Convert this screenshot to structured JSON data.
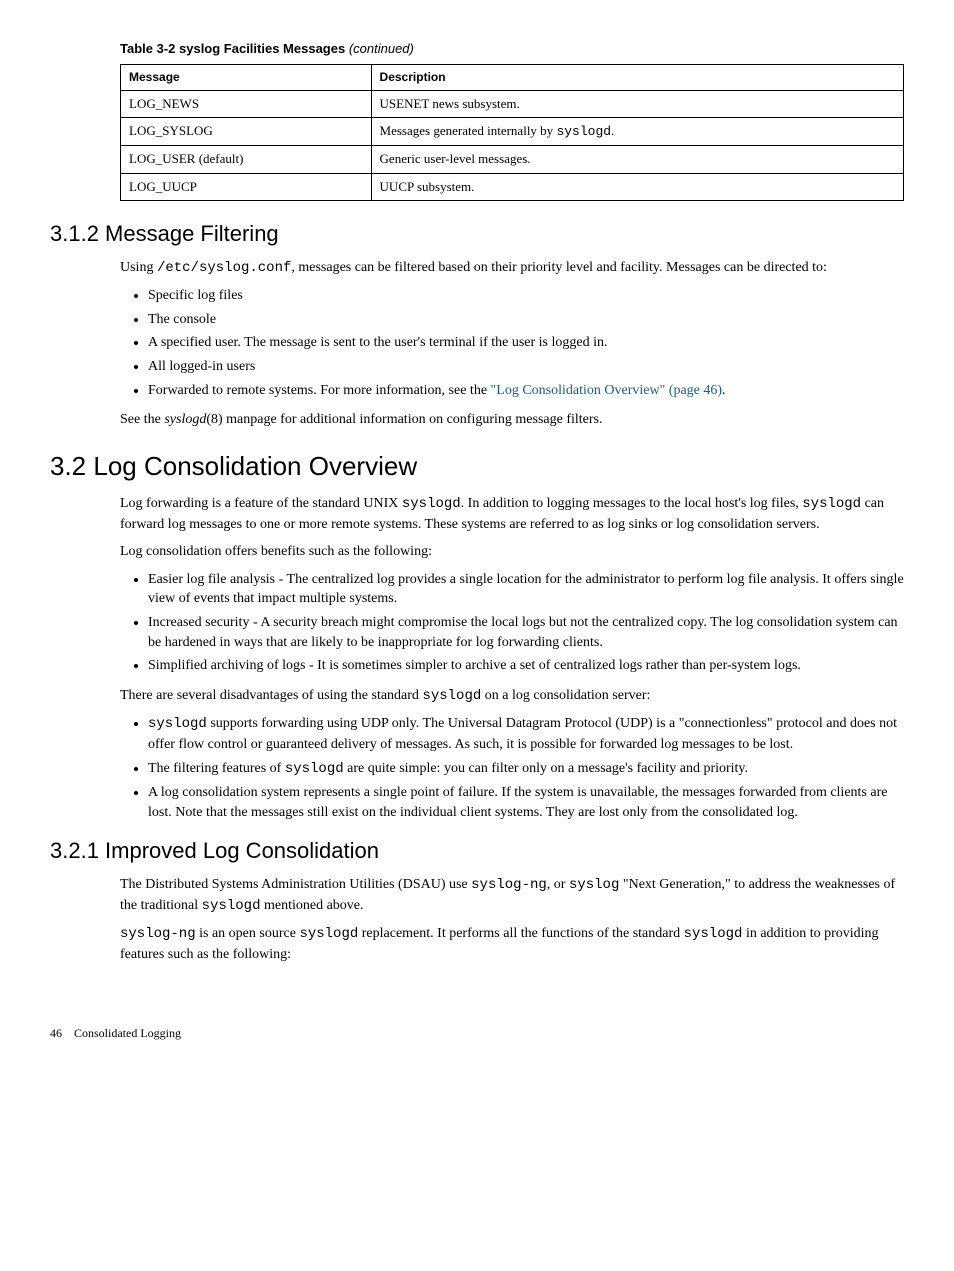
{
  "table": {
    "caption_bold": "Table 3-2 syslog Facilities Messages",
    "caption_italic": " (continued)",
    "headers": [
      "Message",
      "Description"
    ],
    "rows": [
      {
        "msg": "LOG_NEWS",
        "desc_pre": "USENET news subsystem.",
        "desc_code": "",
        "desc_post": ""
      },
      {
        "msg": "LOG_SYSLOG",
        "desc_pre": "Messages generated internally by ",
        "desc_code": "syslogd",
        "desc_post": "."
      },
      {
        "msg": "LOG_USER (default)",
        "desc_pre": "Generic user-level messages.",
        "desc_code": "",
        "desc_post": ""
      },
      {
        "msg": "LOG_UUCP",
        "desc_pre": "UUCP subsystem.",
        "desc_code": "",
        "desc_post": ""
      }
    ]
  },
  "s312": {
    "heading": "3.1.2 Message Filtering",
    "p1_a": "Using ",
    "p1_code": "/etc/syslog.conf",
    "p1_b": ", messages can be filtered based on their priority level and facility. Messages can be directed to:",
    "bullets": {
      "b1": "Specific log files",
      "b2": "The console",
      "b3": "A specified user. The message is sent to the user's terminal if the user is logged in.",
      "b4": "All logged-in users",
      "b5a": "Forwarded to remote systems. For more information, see the ",
      "b5link": "\"Log Consolidation Overview\" (page 46)",
      "b5b": "."
    },
    "p2_a": "See the ",
    "p2_i": "syslogd",
    "p2_b": "(8) manpage for additional information on configuring message filters."
  },
  "s32": {
    "heading": "3.2 Log Consolidation Overview",
    "p1_a": "Log forwarding is a feature of the standard UNIX ",
    "p1_c1": "syslogd",
    "p1_b": ". In addition to logging messages to the local host's log files, ",
    "p1_c2": "syslogd",
    "p1_c": " can forward log messages to one or more remote systems. These systems are referred to as log sinks or log consolidation servers.",
    "p2": "Log consolidation offers benefits such as the following:",
    "bullets1": {
      "b1": "Easier log file analysis - The centralized log provides a single location for the administrator to perform log file analysis. It offers single view of events that impact multiple systems.",
      "b2": "Increased security - A security breach might compromise the local logs but not the centralized copy. The log consolidation system can be hardened in ways that are likely to be inappropriate for log forwarding clients.",
      "b3": "Simplified archiving of logs - It is sometimes simpler to archive a set of centralized logs rather than per-system logs."
    },
    "p3_a": "There are several disadvantages of using the standard ",
    "p3_c": "syslogd",
    "p3_b": " on a log consolidation server:",
    "bullets2": {
      "b1_c": "syslogd",
      "b1_t": " supports forwarding using UDP only. The Universal Datagram Protocol (UDP) is a \"connectionless\" protocol and does not offer flow control or guaranteed delivery of messages. As such, it is possible for forwarded log messages to be lost.",
      "b2_a": "The filtering features of ",
      "b2_c": "syslogd",
      "b2_b": " are quite simple: you can filter only on a message's facility and priority.",
      "b3": "A log consolidation system represents a single point of failure. If the system is unavailable, the messages forwarded from clients are lost. Note that the messages still exist on the individual client systems. They are lost only from the consolidated log."
    }
  },
  "s321": {
    "heading": "3.2.1 Improved Log Consolidation",
    "p1_a": "The Distributed Systems Administration Utilities (DSAU) use ",
    "p1_c1": "syslog-ng",
    "p1_b": ", or ",
    "p1_c2": "syslog",
    "p1_c": " \"Next Generation,\" to address the weaknesses of the traditional ",
    "p1_c3": "syslogd",
    "p1_d": " mentioned above.",
    "p2_c1": "syslog-ng",
    "p2_a": " is an open source ",
    "p2_c2": "syslogd",
    "p2_b": " replacement. It performs all the functions of the standard ",
    "p2_c3": "syslogd",
    "p2_c": " in addition to providing features such as the following:"
  },
  "footer": {
    "page": "46",
    "label": "Consolidated Logging"
  }
}
